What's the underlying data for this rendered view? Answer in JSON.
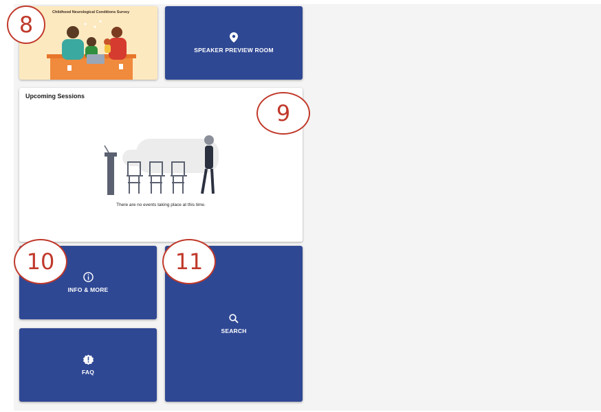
{
  "survey_card": {
    "title": "Childhood Neurological Conditions Survey"
  },
  "tiles": {
    "speaker_preview": {
      "label": "SPEAKER PREVIEW ROOM",
      "icon": "map-pin-icon"
    },
    "info": {
      "label": "INFO & MORE",
      "icon": "info-icon"
    },
    "search": {
      "label": "SEARCH",
      "icon": "search-icon"
    },
    "faq": {
      "label": "FAQ",
      "icon": "alert-badge-icon"
    }
  },
  "sessions": {
    "title": "Upcoming Sessions",
    "empty_message": "There are no events taking place at this time."
  },
  "badges": [
    "8",
    "9",
    "10",
    "11"
  ],
  "colors": {
    "tile": "#2f4894",
    "badge": "#c0392b",
    "survey_bg": "#fde9c0"
  }
}
